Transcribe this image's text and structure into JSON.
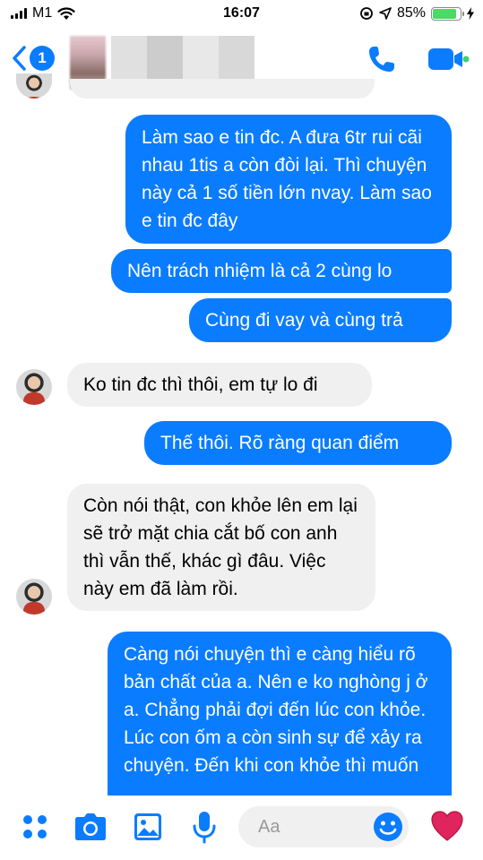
{
  "status_bar": {
    "carrier": "M1",
    "time": "16:07",
    "battery_percent": "85%"
  },
  "header": {
    "back_badge": "1",
    "contact_name": "",
    "colors": {
      "accent": "#0a7cff"
    }
  },
  "messages": [
    {
      "sender": "me",
      "text": "Làm sao e tin đc. A đưa 6tr rui cãi nhau 1tis a còn đòi lại. Thì chuyện này cả 1 số tiền lớn nvay. Làm sao e tin đc đây"
    },
    {
      "sender": "me",
      "text": "Nên trách nhiệm là cả 2 cùng lo"
    },
    {
      "sender": "me",
      "text": "Cùng đi vay và cùng trả"
    },
    {
      "sender": "them",
      "text": "Ko tin đc thì thôi, em tự lo đi"
    },
    {
      "sender": "me",
      "text": "Thế thôi. Rõ ràng quan điểm"
    },
    {
      "sender": "them",
      "text": "Còn nói thật, con khỏe lên em lại sẽ trở mặt chia cắt bố con anh thì vẫn thế, khác gì đâu. Việc này em đã làm rồi."
    },
    {
      "sender": "me",
      "text": "Càng nói chuyện thì e càng hiểu rõ bản chất của a. Nên e ko nghòng j ở a. Chẳng phải đợi đến lúc con khỏe. Lúc con ốm a còn sinh sự để xảy ra chuyện. Đến khi con khỏe thì muốn"
    }
  ],
  "composer": {
    "placeholder": "Aa",
    "icons": [
      "apps-icon",
      "camera-icon",
      "image-icon",
      "microphone-icon",
      "emoji-icon",
      "heart-icon"
    ],
    "colors": {
      "icon": "#0a7cff",
      "heart": "#e0245e"
    }
  }
}
